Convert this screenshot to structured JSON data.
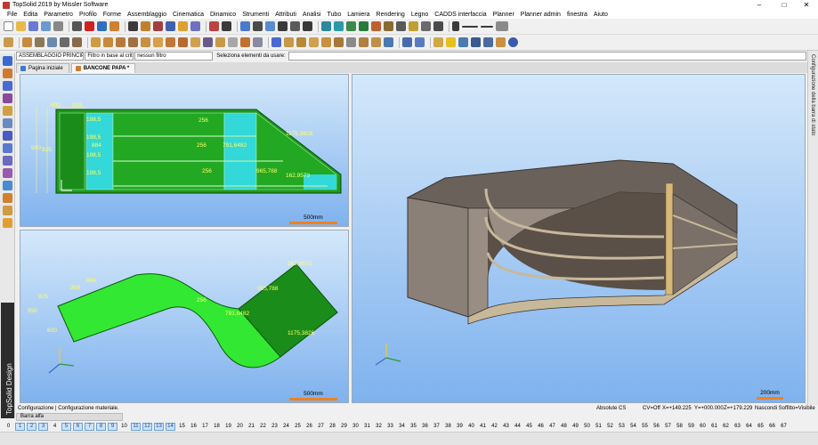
{
  "window": {
    "title": "TopSolid 2019 by Missler Software",
    "minimize": "–",
    "maximize": "□",
    "close": "✕"
  },
  "menu": [
    "File",
    "Edita",
    "Parametro",
    "Profilo",
    "Forme",
    "Assemblaggio",
    "Cinematica",
    "Dinamico",
    "Strumenti",
    "Attributi",
    "Analisi",
    "Tubo",
    "Lamiera",
    "Rendering",
    "Legno",
    "CADDS interfaccia",
    "Planner",
    "Planner admin",
    "finestra",
    "Aiuto"
  ],
  "filterbar": {
    "assembly": "ASSEMBLAGGIO PRINCIPALE",
    "criteria_label": "Filtro in base al criterio",
    "filter_value": "nessun filtro",
    "select_label": "Seleziona elementi da usare:",
    "select_value": ""
  },
  "tabs": [
    {
      "label": "Pagina iniziale",
      "active": false
    },
    {
      "label": "BANCONE PAPA *",
      "active": true
    }
  ],
  "rightstrip": {
    "label": "Configurazione della barra di stato"
  },
  "brand": {
    "text": "TopSolid Design"
  },
  "views": {
    "top": {
      "scale": "500mm",
      "dims": {
        "d600": "600",
        "d309": "309",
        "d950": "950",
        "d925": "925",
        "d1985a": "198,5",
        "d1985b": "198,5",
        "d1985c": "198,5",
        "d1985d": "198,5",
        "d884": "884",
        "d256a": "256",
        "d256b": "256",
        "d256c": "256",
        "d7916482": "791,6482",
        "d11753826": "1175,3826",
        "d965788": "965,788",
        "d1629573": "162,9573"
      }
    },
    "bottom": {
      "scale": "500mm",
      "dims": {
        "d925": "925",
        "d309": "309",
        "d884": "884",
        "d950": "950",
        "d600": "600",
        "d256": "256",
        "d7916482": "791,6482",
        "d965788": "965,788",
        "d1629573": "162,9573",
        "d11753826": "1175,3826"
      }
    },
    "perspective": {
      "scale": "200mm"
    }
  },
  "status": {
    "left": "Configurazione | Configurazione materiale.",
    "cs": "Absolute CS",
    "cv": "CV=Off",
    "x": "X=+149.225",
    "y": "Y=+000.000",
    "z": "Z=+179.229",
    "visibility": "Nascondi  Soffitto=Visibile"
  },
  "subbar": {
    "label": "Barra alfa"
  },
  "layers": {
    "numbers": [
      "0",
      "1",
      "2",
      "3",
      "4",
      "5",
      "6",
      "7",
      "8",
      "9",
      "10",
      "11",
      "12",
      "13",
      "14",
      "15",
      "16",
      "17",
      "18",
      "19",
      "20",
      "21",
      "22",
      "23",
      "24",
      "25",
      "26",
      "27",
      "28",
      "29",
      "30",
      "31",
      "32",
      "33",
      "34",
      "35",
      "36",
      "37",
      "38",
      "39",
      "40",
      "41",
      "42",
      "43",
      "44",
      "45",
      "46",
      "47",
      "48",
      "49",
      "50",
      "51",
      "52",
      "53",
      "54",
      "55",
      "56",
      "57",
      "58",
      "59",
      "60",
      "61",
      "62",
      "63",
      "64",
      "65",
      "66",
      "67"
    ],
    "highlighted": [
      1,
      2,
      3,
      5,
      6,
      7,
      8,
      9,
      11,
      12,
      13,
      14
    ]
  },
  "colors": {
    "panel_green": "#22a822",
    "bright_green": "#33e833",
    "dark_green": "#1a8c1a",
    "cyan": "#33d8d8",
    "viewport_top": "#d4e8fa",
    "viewport_bottom": "#7fb2ee",
    "dim_text": "#ffff66",
    "scale_bar": "#f08020"
  }
}
